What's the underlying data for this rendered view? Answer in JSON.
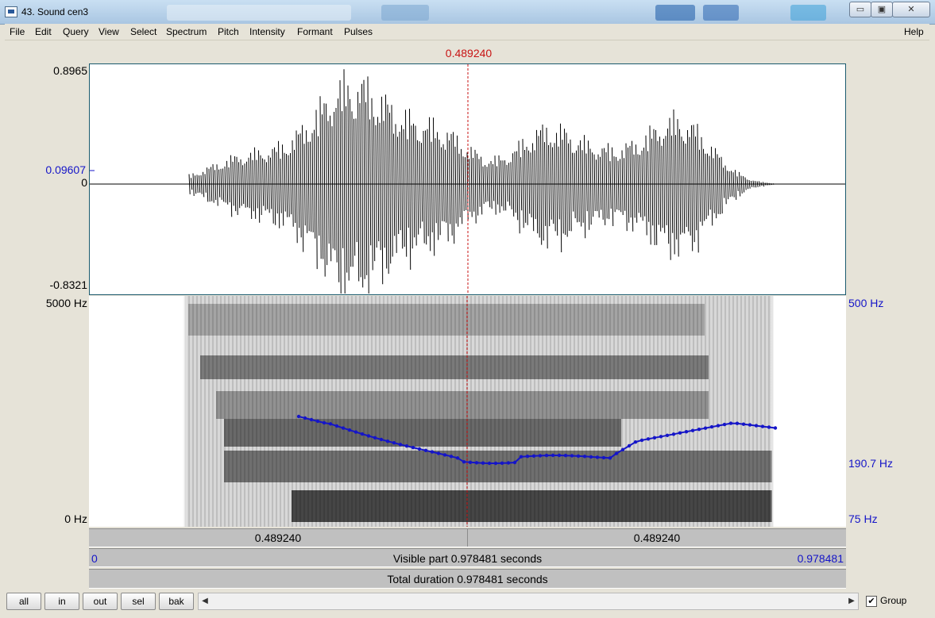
{
  "window": {
    "title": "43. Sound cen3"
  },
  "menu": [
    "File",
    "Edit",
    "Query",
    "View",
    "Select",
    "Spectrum",
    "Pitch",
    "Intensity",
    "Formant",
    "Pulses"
  ],
  "help": "Help",
  "cursor": {
    "time_label": "0.489240"
  },
  "waveform": {
    "max_label": "0.8965",
    "level_label": "0.09607",
    "zero_label": "0",
    "min_label": "-0.8321"
  },
  "spectrogram": {
    "top_label": "5000 Hz",
    "bottom_label": "0 Hz"
  },
  "pitch_axis": {
    "top_label": "500 Hz",
    "value_label": "190.7 Hz",
    "bottom_label": "75 Hz"
  },
  "time_bars": {
    "left_segment": "0.489240",
    "right_segment": "0.489240",
    "visible_start": "0",
    "visible_text": "Visible part 0.978481 seconds",
    "visible_end": "0.978481",
    "total_text": "Total duration 0.978481 seconds"
  },
  "buttons": {
    "all": "all",
    "in": "in",
    "out": "out",
    "sel": "sel",
    "bak": "bak"
  },
  "group": {
    "label": "Group",
    "checked": true,
    "mark": "✔"
  },
  "window_controls": {
    "minimize": "▭",
    "maximize": "▣",
    "close": "✕"
  },
  "colors": {
    "cursor": "#c81414",
    "pitch": "#1515c8",
    "waveform": "#000000"
  }
}
